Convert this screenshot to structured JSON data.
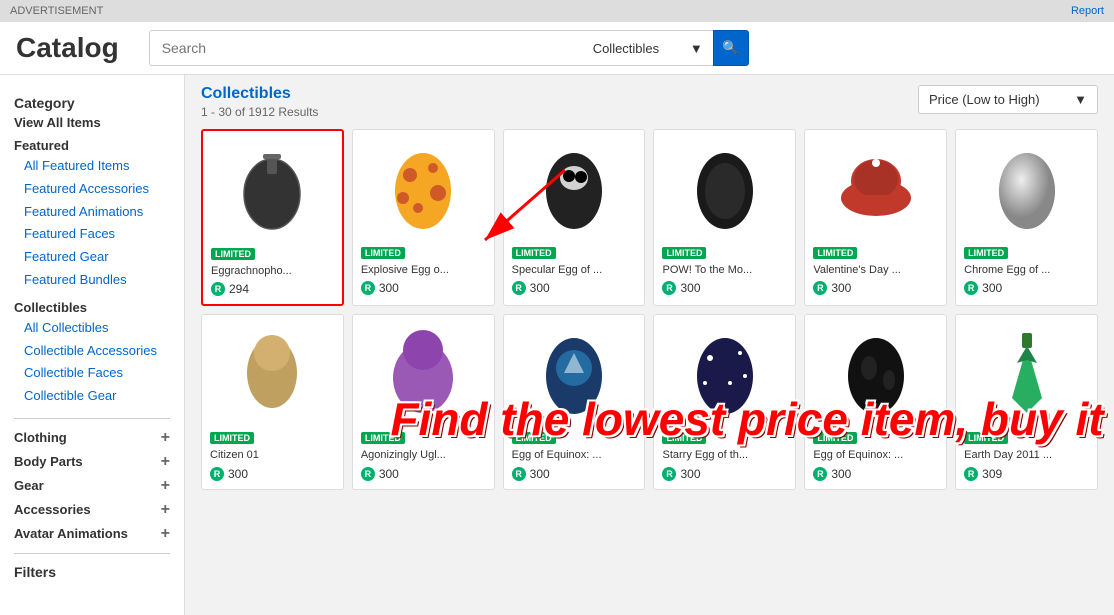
{
  "adBar": {
    "advertisement": "ADVERTISEMENT",
    "report": "Report"
  },
  "header": {
    "title": "Catalog",
    "search": {
      "placeholder": "Search",
      "dropdown": "Collectibles",
      "buttonIcon": "🔍"
    }
  },
  "sidebar": {
    "categoryTitle": "Category",
    "viewAllLabel": "View All Items",
    "featured": {
      "label": "Featured",
      "items": [
        "All Featured Items",
        "Featured Accessories",
        "Featured Animations",
        "Featured Faces",
        "Featured Gear",
        "Featured Bundles"
      ]
    },
    "collectibles": {
      "label": "Collectibles",
      "items": [
        "All Collectibles",
        "Collectible Accessories",
        "Collectible Faces",
        "Collectible Gear"
      ]
    },
    "clothing": {
      "label": "Clothing",
      "hasPlus": true
    },
    "bodyParts": {
      "label": "Body Parts",
      "hasPlus": true
    },
    "gear": {
      "label": "Gear",
      "hasPlus": true
    },
    "accessories": {
      "label": "Accessories",
      "hasPlus": true
    },
    "avatarAnimations": {
      "label": "Avatar Animations",
      "hasPlus": true
    },
    "filtersTitle": "Filters"
  },
  "content": {
    "breadcrumb": "Collectibles",
    "resultCount": "1 - 30 of 1912 Results",
    "sortLabel": "Price (Low to High)",
    "chevron": "▼"
  },
  "items": [
    {
      "id": 1,
      "name": "Eggrachnopho...",
      "badge": "LIMITED",
      "price": "294",
      "highlighted": true,
      "shape": "grenade"
    },
    {
      "id": 2,
      "name": "Explosive Egg o...",
      "badge": "LIMITED",
      "price": "300",
      "highlighted": false,
      "shape": "egg-orange"
    },
    {
      "id": 3,
      "name": "Specular Egg of ...",
      "badge": "LIMITED",
      "price": "300",
      "highlighted": false,
      "shape": "egg-black"
    },
    {
      "id": 4,
      "name": "POW! To the Mo...",
      "badge": "LIMITED",
      "price": "300",
      "highlighted": false,
      "shape": "egg-dark"
    },
    {
      "id": 5,
      "name": "Valentine's Day ...",
      "badge": "LIMITED",
      "price": "300",
      "highlighted": false,
      "shape": "cap"
    },
    {
      "id": 6,
      "name": "Chrome Egg of ...",
      "badge": "LIMITED",
      "price": "300",
      "highlighted": false,
      "shape": "egg-silver"
    },
    {
      "id": 7,
      "name": "Citizen 01",
      "badge": "LIMITED",
      "price": "300",
      "highlighted": false,
      "shape": "blob1"
    },
    {
      "id": 8,
      "name": "Agonizingly Ugl...",
      "badge": "LIMITED",
      "price": "300",
      "highlighted": false,
      "shape": "blob2"
    },
    {
      "id": 9,
      "name": "Egg of Equinox: ...",
      "badge": "LIMITED",
      "price": "300",
      "highlighted": false,
      "shape": "egg-blue"
    },
    {
      "id": 10,
      "name": "Starry Egg of th...",
      "badge": "LIMITED",
      "price": "300",
      "highlighted": false,
      "shape": "egg-star"
    },
    {
      "id": 11,
      "name": "Egg of Equinox: ...",
      "badge": "LIMITED",
      "price": "300",
      "highlighted": false,
      "shape": "egg-dark2"
    },
    {
      "id": 12,
      "name": "Earth Day 2011 ...",
      "badge": "LIMITED",
      "price": "309",
      "highlighted": false,
      "shape": "tie"
    }
  ],
  "overlay": {
    "text": "Find the lowest price item, buy it"
  },
  "arrowTarget": "item-1"
}
